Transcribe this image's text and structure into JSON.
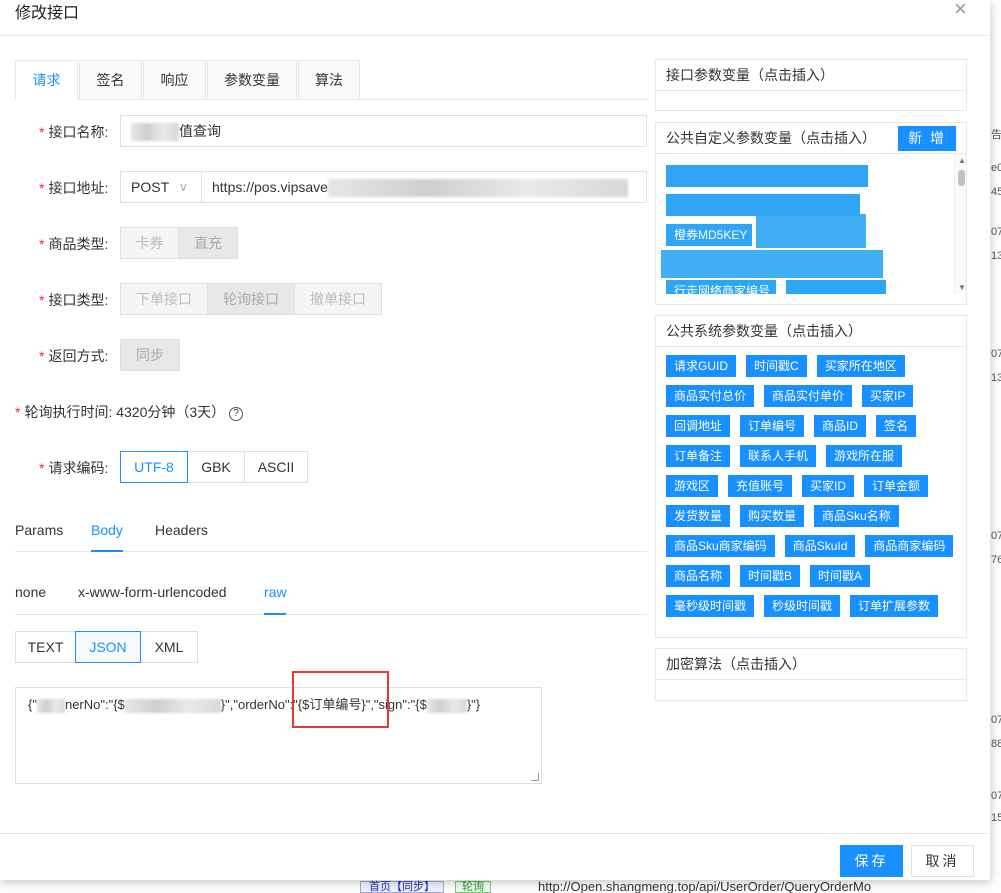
{
  "modal": {
    "title": "修改接口",
    "close_glyph": "×"
  },
  "tabs": [
    {
      "label": "请求",
      "active": true
    },
    {
      "label": "签名"
    },
    {
      "label": "响应"
    },
    {
      "label": "参数变量"
    },
    {
      "label": "算法"
    }
  ],
  "form": {
    "name": {
      "label": "接口名称:",
      "value_suffix": "值查询"
    },
    "url": {
      "label": "接口地址:",
      "method": "POST",
      "method_chevron": "∨",
      "value_prefix": "https://pos.vipsave"
    },
    "product_type": {
      "label": "商品类型:",
      "options": [
        "卡券",
        "直充"
      ],
      "selected": "直充"
    },
    "api_type": {
      "label": "接口类型:",
      "options": [
        "下单接口",
        "轮询接口",
        "撤单接口"
      ],
      "selected": "轮询接口"
    },
    "return_mode": {
      "label": "返回方式:",
      "options": [
        "同步"
      ]
    },
    "poll_time": {
      "label": "轮询执行时间: 4320分钟（3天）",
      "help": "?"
    },
    "encoding": {
      "label": "请求编码:",
      "options": [
        "UTF-8",
        "GBK",
        "ASCII"
      ],
      "selected": "UTF-8"
    }
  },
  "request_tabs": [
    {
      "label": "Params"
    },
    {
      "label": "Body",
      "active": true
    },
    {
      "label": "Headers"
    }
  ],
  "body_types": [
    {
      "label": "none"
    },
    {
      "label": "x-www-form-urlencoded"
    },
    {
      "label": "raw",
      "active": true
    }
  ],
  "raw_formats": [
    {
      "label": "TEXT"
    },
    {
      "label": "JSON",
      "active": true
    },
    {
      "label": "XML"
    }
  ],
  "body": {
    "part1": "{\"",
    "part2": "nerNo\":\"{$",
    "part3": "}\",\"orderNo\":\"{$订单编号}\",\"sign\":\"{$",
    "part4": "}\"}"
  },
  "panels": {
    "api_params": {
      "title": "接口参数变量（点击插入）"
    },
    "custom_params": {
      "title": "公共自定义参数变量（点击插入）",
      "new_label": "新 增",
      "visible_items": [
        "橙券MD5KEY",
        "行走网络商家编号"
      ]
    },
    "system_params": {
      "title": "公共系统参数变量（点击插入）",
      "rows": [
        [
          "请求GUID",
          "时间戳C",
          "买家所在地区"
        ],
        [
          "商品实付总价",
          "商品实付单价",
          "买家IP"
        ],
        [
          "回调地址",
          "订单编号",
          "商品ID",
          "签名"
        ],
        [
          "订单备注",
          "联系人手机",
          "游戏所在服"
        ],
        [
          "游戏区",
          "充值账号",
          "买家ID",
          "订单金额"
        ],
        [
          "发货数量",
          "购买数量",
          "商品Sku名称"
        ],
        [
          "商品Sku商家编码",
          "商品SkuId",
          "商品商家编码"
        ],
        [
          "商品名称",
          "时间戳B",
          "时间戳A"
        ],
        [
          "毫秒级时间戳",
          "秒级时间戳",
          "订单扩展参数"
        ]
      ]
    },
    "encrypt": {
      "title": "加密算法（点击插入）"
    }
  },
  "footer": {
    "save_label": "保存",
    "cancel_label": "取消"
  },
  "background": {
    "bottom_left_badge": "首页【同步】",
    "bottom_badge2": "轮询",
    "bottom_url": "http://Open.shangmeng.top/api/UserOrder/QueryOrderMo",
    "right_fragments": [
      "告回",
      "e0",
      "45",
      "07",
      "13",
      "07",
      "13",
      "07",
      "76",
      "07",
      "88",
      "07",
      "15"
    ]
  },
  "colors": {
    "primary": "#1890ff",
    "required": "#f5222d",
    "highlight_box": "#e53935",
    "tag_bg": "#1890ff"
  }
}
